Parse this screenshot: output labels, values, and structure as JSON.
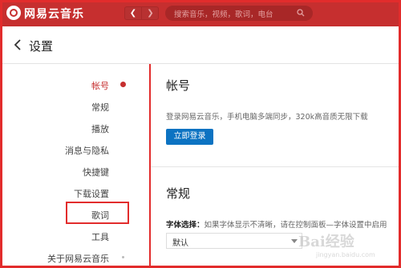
{
  "app": {
    "title": "网易云音乐"
  },
  "nav": {
    "back_icon": "chevron-left",
    "forward_icon": "chevron-right"
  },
  "search": {
    "placeholder": "搜索音乐，视频，歌词，电台",
    "icon": "search-icon"
  },
  "header": {
    "title": "设置"
  },
  "sidebar": {
    "active": "帐号",
    "items": [
      {
        "label": "帐号"
      },
      {
        "label": "常规"
      },
      {
        "label": "播放"
      },
      {
        "label": "消息与隐私"
      },
      {
        "label": "快捷键"
      },
      {
        "label": "下载设置"
      },
      {
        "label": "歌词"
      },
      {
        "label": "工具"
      },
      {
        "label": "关于网易云音乐"
      }
    ]
  },
  "account": {
    "title": "帐号",
    "description": "登录网易云音乐，手机电脑多端同步，320k高音质无限下载",
    "login_button": "立即登录"
  },
  "general": {
    "title": "常规",
    "font_label": "字体选择：",
    "font_hint": "如果字体显示不清晰，请在控制面板—字体设置中启用",
    "font_value": "默认"
  },
  "watermark": {
    "main": "Bai经验",
    "sub": "jingyan.baidu.com"
  },
  "colors": {
    "brand": "#c62f2f",
    "button": "#0c73c2",
    "annotation": "#e22c2c"
  }
}
